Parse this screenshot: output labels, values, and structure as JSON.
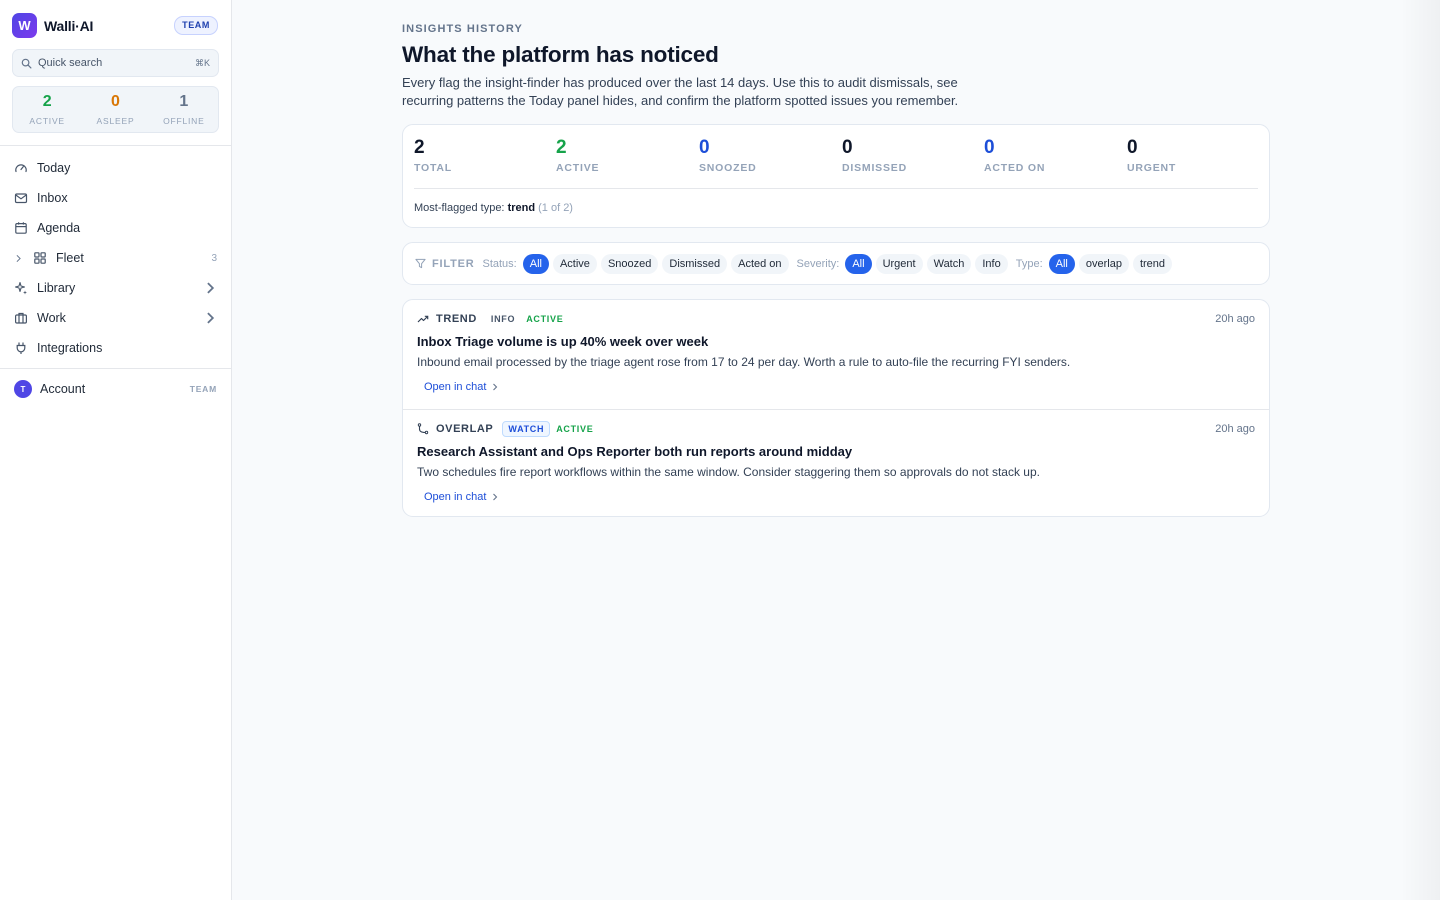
{
  "brand": {
    "initial": "W",
    "name": "Walli·AI",
    "badge": "TEAM"
  },
  "search": {
    "label": "Quick search",
    "shortcut": "⌘K"
  },
  "fleet_stats": [
    {
      "value": "2",
      "label": "ACTIVE",
      "color": "#16a34a"
    },
    {
      "value": "0",
      "label": "ASLEEP",
      "color": "#d97706"
    },
    {
      "value": "1",
      "label": "OFFLINE",
      "color": "#64748b"
    }
  ],
  "nav": {
    "today": "Today",
    "inbox": "Inbox",
    "agenda": "Agenda",
    "fleet": "Fleet",
    "fleet_count": "3",
    "library": "Library",
    "work": "Work",
    "integrations": "Integrations"
  },
  "account": {
    "initial": "T",
    "name": "Account",
    "badge": "TEAM"
  },
  "header": {
    "eyebrow": "INSIGHTS HISTORY",
    "title": "What the platform has noticed",
    "description": "Every flag the insight-finder has produced over the last 14 days. Use this to audit dismissals, see recurring patterns the Today panel hides, and confirm the platform spotted issues you remember."
  },
  "summary": {
    "stats": [
      {
        "value": "2",
        "label": "TOTAL",
        "color": "#0f172a"
      },
      {
        "value": "2",
        "label": "ACTIVE",
        "color": "#16a34a"
      },
      {
        "value": "0",
        "label": "SNOOZED",
        "color": "#1d4ed8"
      },
      {
        "value": "0",
        "label": "DISMISSED",
        "color": "#0f172a"
      },
      {
        "value": "0",
        "label": "ACTED ON",
        "color": "#1d4ed8"
      },
      {
        "value": "0",
        "label": "URGENT",
        "color": "#0f172a"
      }
    ],
    "most_prefix": "Most-flagged type:",
    "most_type": "trend",
    "most_count": "(1 of 2)"
  },
  "filter": {
    "label": "FILTER",
    "status_label": "Status:",
    "status_options": [
      "All",
      "Active",
      "Snoozed",
      "Dismissed",
      "Acted on"
    ],
    "severity_label": "Severity:",
    "severity_options": [
      "All",
      "Urgent",
      "Watch",
      "Info"
    ],
    "type_label": "Type:",
    "type_options": [
      "All",
      "overlap",
      "trend"
    ]
  },
  "insights": [
    {
      "type": "TREND",
      "severity": "INFO",
      "state": "ACTIVE",
      "time": "20h ago",
      "title": "Inbox Triage volume is up 40% week over week",
      "body": "Inbound email processed by the triage agent rose from 17 to 24 per day. Worth a rule to auto-file the recurring FYI senders.",
      "link": "Open in chat"
    },
    {
      "type": "OVERLAP",
      "severity": "WATCH",
      "state": "ACTIVE",
      "time": "20h ago",
      "title": "Research Assistant and Ops Reporter both run reports around midday",
      "body": "Two schedules fire report workflows within the same window. Consider staggering them so approvals do not stack up.",
      "link": "Open in chat"
    }
  ]
}
